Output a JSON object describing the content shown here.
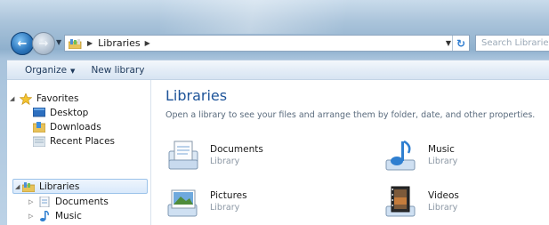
{
  "address_bar": {
    "path": [
      "Libraries"
    ],
    "search_placeholder": "Search Libraries"
  },
  "toolbar": {
    "organize_label": "Organize",
    "new_library_label": "New library"
  },
  "navigation": {
    "favorites": {
      "label": "Favorites",
      "items": [
        {
          "label": "Desktop",
          "icon": "desktop-icon"
        },
        {
          "label": "Downloads",
          "icon": "downloads-icon"
        },
        {
          "label": "Recent Places",
          "icon": "recent-places-icon"
        }
      ]
    },
    "libraries": {
      "label": "Libraries",
      "selected": true,
      "items": [
        {
          "label": "Documents",
          "icon": "documents-icon"
        },
        {
          "label": "Music",
          "icon": "music-icon"
        }
      ]
    }
  },
  "content": {
    "title": "Libraries",
    "subtitle": "Open a library to see your files and arrange them by folder, date, and other properties.",
    "libraries": [
      {
        "name": "Documents",
        "type": "Library",
        "icon": "documents-library-icon"
      },
      {
        "name": "Music",
        "type": "Library",
        "icon": "music-library-icon"
      },
      {
        "name": "Pictures",
        "type": "Library",
        "icon": "pictures-library-icon"
      },
      {
        "name": "Videos",
        "type": "Library",
        "icon": "videos-library-icon"
      }
    ]
  },
  "colors": {
    "title_blue": "#1e5499",
    "selection_bg": "#d9e9fb",
    "selection_border": "#9cc3ea"
  }
}
